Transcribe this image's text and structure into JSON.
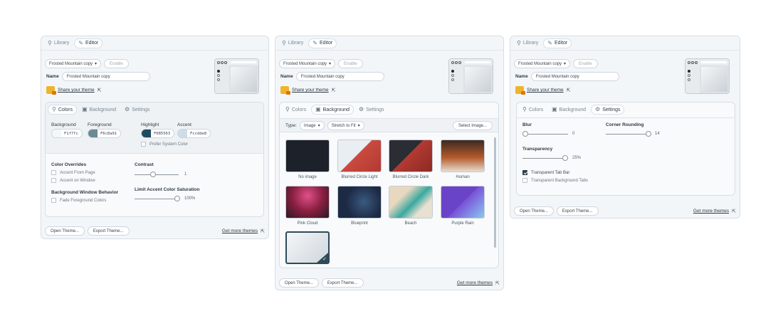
{
  "common": {
    "tabs": {
      "library": "Library",
      "editor": "Editor"
    },
    "theme_select": "Frosted Mountain copy",
    "enable": "Enable",
    "name_label": "Name",
    "name_value": "Frosted Mountain copy",
    "share": "Share your theme",
    "subtabs": {
      "colors": "Colors",
      "background": "Background",
      "settings": "Settings"
    },
    "footer": {
      "open": "Open Theme...",
      "export": "Export Theme...",
      "more": "Get more themes"
    }
  },
  "colors_panel": {
    "background_label": "Background",
    "background_value": "F1f7fc",
    "background_color": "#f1f7fc",
    "foreground_label": "Foreground",
    "foreground_value": "F6c8a91",
    "foreground_color": "#6c8a91",
    "highlight_label": "Highlight",
    "highlight_value": "F085563",
    "highlight_color": "#1f4a5e",
    "accent_label": "Accent",
    "accent_value": "Fccdde8",
    "accent_color": "#ccdde8",
    "prefer_system": "Prefer System Color",
    "overrides_title": "Color Overrides",
    "accent_from_page": "Accent From Page",
    "accent_on_window": "Accent on Window",
    "bg_behavior_title": "Background Window Behavior",
    "fade_fg": "Fade Foreground Colors",
    "contrast_label": "Contrast",
    "contrast_value": "1",
    "limit_label": "Limit Accent Color Saturation",
    "limit_value": "100%"
  },
  "background_panel": {
    "type_label": "Type:",
    "type_value": "Image",
    "fit_value": "Stretch to Fit",
    "select_image": "Select Image...",
    "images": [
      {
        "label": "No image",
        "color": "#1d2129"
      },
      {
        "label": "Blurred Circle Light",
        "color": "#c94a3e"
      },
      {
        "label": "Blurred Circle Dark",
        "color": "#b33a32"
      },
      {
        "label": "Human",
        "color": "#b35a2a"
      },
      {
        "label": "Pink Cloud",
        "color": "#8a2040"
      },
      {
        "label": "Blueprint",
        "color": "#1c2a44"
      },
      {
        "label": "Beach",
        "color": "#3aa8a0"
      },
      {
        "label": "Purple Rain",
        "color": "#7a52d8"
      },
      {
        "label": "",
        "color": "#dfe4e8"
      }
    ]
  },
  "settings_panel": {
    "blur_label": "Blur",
    "blur_value": "0",
    "blur_level": 0,
    "rounding_label": "Corner Rounding",
    "rounding_value": "14",
    "rounding_level": 1,
    "transparency_label": "Transparency",
    "transparency_value": "25%",
    "transparency_level": 1,
    "transparent_tab_bar": "Transparent Tab Bar",
    "transparent_bg_tabs": "Transparent Background Tabs"
  }
}
